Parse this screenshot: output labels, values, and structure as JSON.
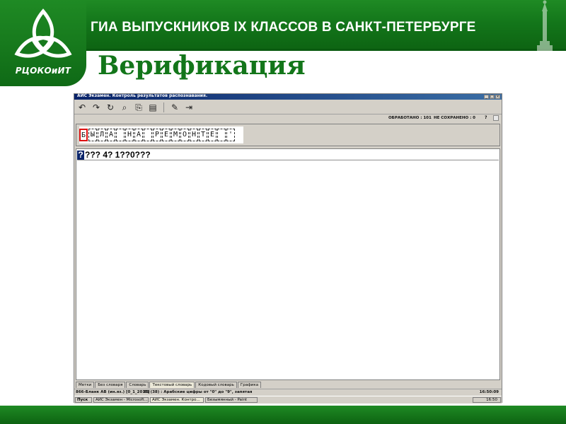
{
  "slide": {
    "header_title": "ГИА ВЫПУСКНИКОВ IX КЛАССОВ В САНКТ-ПЕТЕРБУРГЕ",
    "logo_text": "РЦОКОиИТ",
    "heading": "Верификация",
    "accent_color": "#13761a"
  },
  "app": {
    "title": "АИС Экзамен. Контроль результатов распознавания.",
    "window_buttons": [
      "_",
      "□",
      "×"
    ],
    "toolbar": {
      "buttons": [
        {
          "name": "undo-button",
          "icon": "↶"
        },
        {
          "name": "redo-button",
          "icon": "↷"
        },
        {
          "name": "refresh-button",
          "icon": "↻"
        },
        {
          "name": "search-button",
          "icon": "⌕"
        },
        {
          "name": "copy-button",
          "icon": "⎘"
        },
        {
          "name": "document-button",
          "icon": "▤"
        },
        {
          "name": "edit-button",
          "icon": "✎"
        },
        {
          "name": "export-button",
          "icon": "⇥"
        }
      ]
    },
    "status": {
      "processed": "ОБРАБОТАНО : 101",
      "not_saved": "НЕ СОХРАНЕНО : 0",
      "help": "?"
    },
    "image_cells": [
      "Б",
      "Ы",
      "Л",
      "А",
      " ",
      "Н",
      "А",
      " ",
      "Р",
      "Е",
      "М",
      "О",
      "Н",
      "Т",
      "Е",
      " ",
      "'"
    ],
    "recognized_text": "??? 4? 1??0???",
    "unknown_marker": "?",
    "tabs": [
      {
        "label": "Метки",
        "active": false
      },
      {
        "label": "Без словаря",
        "active": false
      },
      {
        "label": "Словарь",
        "active": false
      },
      {
        "label": "Текстовый словарь",
        "active": true
      },
      {
        "label": "Кодовый словарь",
        "active": false
      },
      {
        "label": "Графика",
        "active": false
      }
    ],
    "bottom_status": {
      "left": "866-Бланк АВ (ин.яз.) [0_1_2015]",
      "field": "85 (38) : Арабские цифры от \"0\" до \"9\", запятая",
      "time": "16:50:09"
    },
    "taskbar": {
      "start": "Пуск",
      "items": [
        {
          "label": "АИС Экзамен - Microsoft...",
          "active": false
        },
        {
          "label": "АИС Экзамен. Контро...",
          "active": true
        },
        {
          "label": "Безымянный - Paint",
          "active": false
        }
      ],
      "clock": "16:50"
    }
  }
}
